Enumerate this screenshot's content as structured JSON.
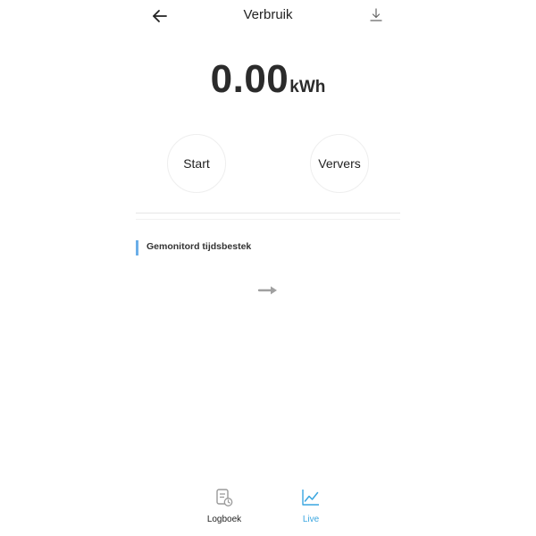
{
  "header": {
    "title": "Verbruik",
    "back_icon": "arrow-left-icon",
    "download_icon": "download-icon"
  },
  "readout": {
    "value": "0.00",
    "unit": "kWh"
  },
  "actions": {
    "start_label": "Start",
    "refresh_label": "Ververs"
  },
  "section": {
    "title": "Gemonitord tijdsbestek",
    "accent_color": "#6aaee8",
    "arrow_icon": "arrow-right-icon"
  },
  "tabs": [
    {
      "label": "Logboek",
      "icon": "logbook-icon",
      "active": false
    },
    {
      "label": "Live",
      "icon": "line-chart-icon",
      "active": true
    }
  ],
  "colors": {
    "active_tab": "#3aa6e0",
    "inactive_icon": "#9a9a9a"
  }
}
